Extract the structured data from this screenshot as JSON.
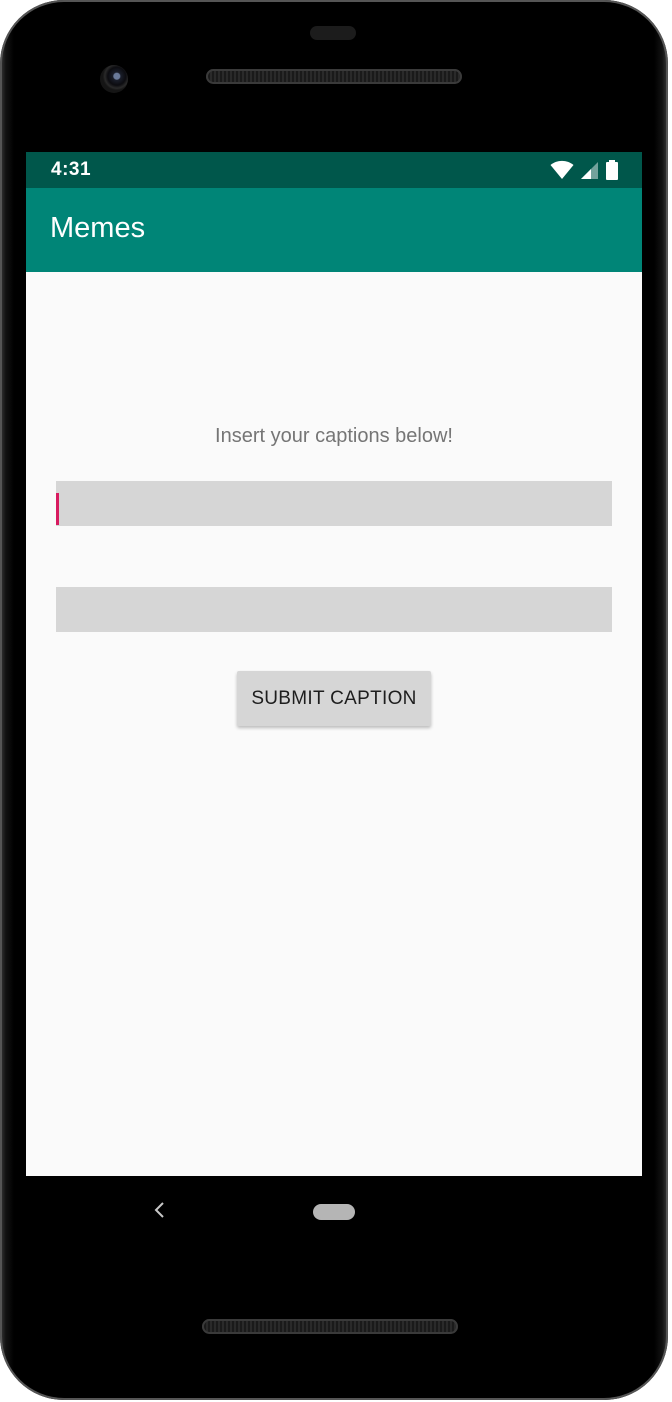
{
  "status_bar": {
    "time": "4:31",
    "icons": [
      "wifi-icon",
      "cell-signal-icon",
      "battery-icon"
    ],
    "background": "#00574b"
  },
  "app_bar": {
    "title": "Memes",
    "background": "#008577"
  },
  "main": {
    "instructions": "Insert your captions below!",
    "caption_top": {
      "value": "",
      "placeholder": ""
    },
    "caption_bottom": {
      "value": "",
      "placeholder": ""
    },
    "submit_label": "SUBMIT CAPTION",
    "cursor_color": "#d81b60"
  },
  "navigation": {
    "back": "back-icon",
    "home": "home-pill-icon"
  }
}
